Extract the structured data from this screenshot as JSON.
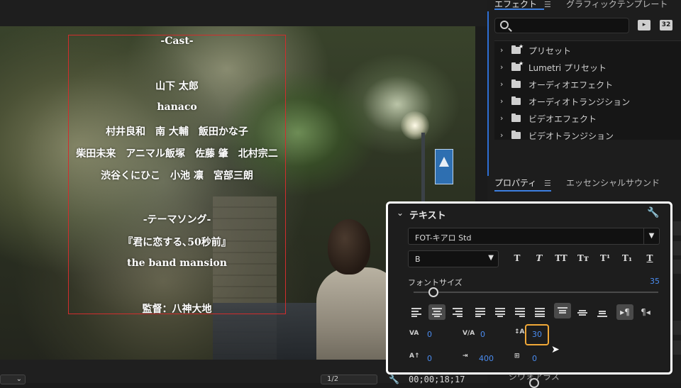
{
  "program_monitor": {
    "credits": {
      "heading": "-Cast-",
      "lines": [
        "山下 太郎",
        "hanaco",
        "村井良和　南 大輔　飯田かな子",
        "柴田未来　アニマル飯塚　佐藤 肇　北村宗二",
        "渋谷くにひこ　小池 凛　宮部三朗"
      ],
      "theme_heading": "-テーマソング-",
      "song": "『君に恋する､50秒前』",
      "band": "the band mansion",
      "director": "監督：八神大地"
    },
    "resolution": "1/2",
    "timecode": "00;00;18;17"
  },
  "effects_panel": {
    "tabs": [
      "エフェクト",
      "グラフィックテンプレート"
    ],
    "search": {
      "placeholder": ""
    },
    "buttons": [
      "32"
    ],
    "items": [
      {
        "label": "プリセット",
        "type": "preset"
      },
      {
        "label": "Lumetri プリセット",
        "type": "preset"
      },
      {
        "label": "オーディオエフェクト",
        "type": "folder"
      },
      {
        "label": "オーディオトランジション",
        "type": "folder"
      },
      {
        "label": "ビデオエフェクト",
        "type": "folder"
      },
      {
        "label": "ビデオトランジション",
        "type": "folder"
      }
    ]
  },
  "properties_panel": {
    "tabs": [
      "プロパティ",
      "エッセンシャルサウンド"
    ],
    "bottom_label": "ジウォアラス"
  },
  "text_section": {
    "title": "テキスト",
    "font": "FOT-キアロ Std",
    "style": "B",
    "format_buttons": [
      "T",
      "T",
      "TT",
      "Tт",
      "T¹",
      "T₁",
      "T"
    ],
    "font_size_label": "フォントサイズ",
    "font_size_value": "35",
    "font_size_fraction": 0.08,
    "kerning": "0",
    "tracking": "0",
    "leading": "30",
    "baseline_shift": "0",
    "tsume": "400",
    "tab_width": "0"
  },
  "colors": {
    "accent_blue": "#3d7fe0",
    "value_blue": "#4a8cf0",
    "highlight_orange": "#f0a838",
    "title_safe_red": "#d12d2d"
  }
}
